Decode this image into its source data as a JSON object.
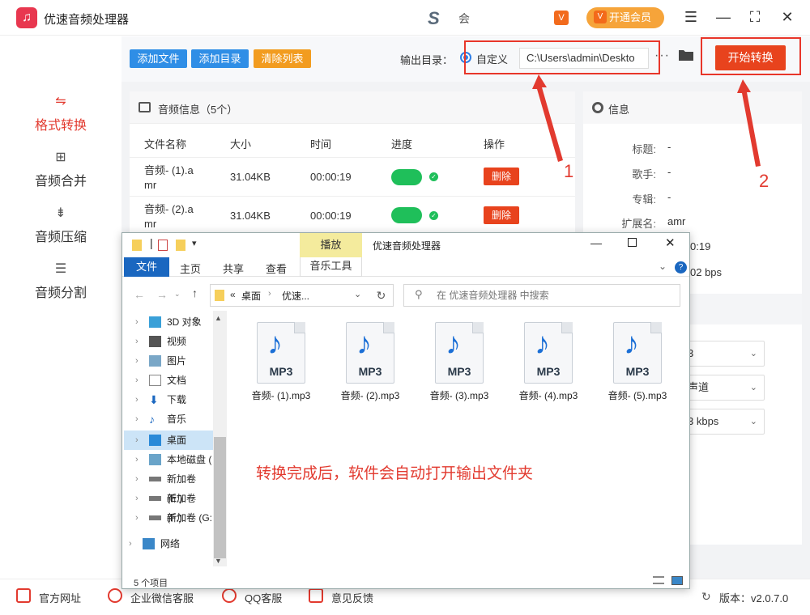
{
  "app": {
    "title": "优速音频处理器",
    "user_text": "会",
    "vip_label": "开通会员",
    "version": "版本：v2.0.7.0"
  },
  "toolbar": {
    "add_file": "添加文件",
    "add_dir": "添加目录",
    "clear_list": "清除列表",
    "output_label": "输出目录：",
    "custom_label": "自定义",
    "output_path": "C:\\Users\\admin\\Deskto",
    "more": "···",
    "start": "开始转换"
  },
  "sidebar": {
    "items": [
      {
        "label": "格式转换",
        "active": true
      },
      {
        "label": "音频合并"
      },
      {
        "label": "音频压缩"
      },
      {
        "label": "音频分割"
      }
    ]
  },
  "list": {
    "title": "音频信息（5个）",
    "headers": [
      "文件名称",
      "大小",
      "时间",
      "进度",
      "操作"
    ],
    "rows": [
      {
        "name_l1": "音频- (1).a",
        "name_l2": "mr",
        "size": "31.04KB",
        "time": "00:00:19",
        "action": "删除"
      },
      {
        "name_l1": "音频- (2).a",
        "name_l2": "mr",
        "size": "31.04KB",
        "time": "00:00:19",
        "action": "删除"
      }
    ]
  },
  "info": {
    "title": "信息",
    "fields": [
      {
        "k": "标题:",
        "v": "-"
      },
      {
        "k": "歌手:",
        "v": "-"
      },
      {
        "k": "专辑:",
        "v": "-"
      },
      {
        "k": "扩展名:",
        "v": "amr"
      }
    ],
    "partial_time": "0:19",
    "partial_bitrate": "02 bps",
    "selects": [
      "3",
      "声道",
      "3 kbps"
    ]
  },
  "annotations": {
    "num1": "1",
    "num2": "2",
    "text": "转换完成后，软件会自动打开输出文件夹"
  },
  "footer": {
    "links": [
      "官方网址",
      "企业微信客服",
      "QQ客服",
      "意见反馈"
    ]
  },
  "explorer": {
    "title": "优速音频处理器",
    "play_tab": "播放",
    "tabs": [
      "文件",
      "主页",
      "共享",
      "查看",
      "音乐工具"
    ],
    "addr_sep": "«",
    "addr_parts": [
      "桌面",
      "优速..."
    ],
    "search_placeholder": "在 优速音频处理器 中搜索",
    "tree": [
      {
        "label": "3D 对象",
        "icon": "3d-objects-icon"
      },
      {
        "label": "视频",
        "icon": "video-icon"
      },
      {
        "label": "图片",
        "icon": "pictures-icon"
      },
      {
        "label": "文档",
        "icon": "documents-icon"
      },
      {
        "label": "下载",
        "icon": "download-icon"
      },
      {
        "label": "音乐",
        "icon": "music-icon"
      },
      {
        "label": "桌面",
        "icon": "desktop-icon",
        "selected": true
      },
      {
        "label": "本地磁盘 (",
        "icon": "local-disk-icon"
      },
      {
        "label": "新加卷 (E:)",
        "icon": "drive-icon"
      },
      {
        "label": "新加卷 (F:)",
        "icon": "drive-icon"
      },
      {
        "label": "新加卷 (G:",
        "icon": "drive-icon"
      },
      {
        "label": "网络",
        "icon": "network-icon"
      }
    ],
    "files": [
      {
        "name": "音频- (1).mp3",
        "badge": "MP3"
      },
      {
        "name": "音频- (2).mp3",
        "badge": "MP3"
      },
      {
        "name": "音频- (3).mp3",
        "badge": "MP3"
      },
      {
        "name": "音频- (4).mp3",
        "badge": "MP3"
      },
      {
        "name": "音频- (5).mp3",
        "badge": "MP3"
      }
    ],
    "status": "5 个项目"
  },
  "colors": {
    "accent": "#e8431d",
    "blue_btn": "#2f8ee6",
    "orange_btn": "#f29c1f",
    "progress": "#1fbf5a",
    "annotation": "#e23a2f"
  }
}
